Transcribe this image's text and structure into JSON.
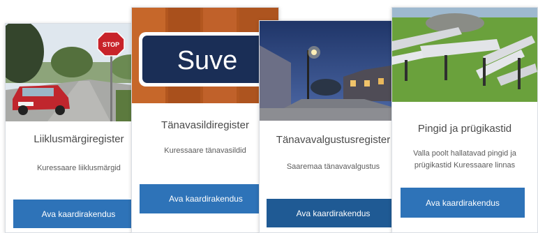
{
  "cards": [
    {
      "title": "Liiklusmärgiregister",
      "description": "Kuressaare liiklusmärgid",
      "button_label": "Ava kaardirakendus",
      "image_subject": "street-with-stop-sign-and-red-car",
      "sign_text": "STOP"
    },
    {
      "title": "Tänavasildiregister",
      "description": "Kuressaare tänavasildid",
      "button_label": "Ava kaardirakendus",
      "image_subject": "street-name-sign-on-wooden-fence",
      "sign_text": "Suve"
    },
    {
      "title": "Tänavavalgustusregister",
      "description": "Saaremaa tänavavalgustus",
      "button_label": "Ava kaardirakendus",
      "image_subject": "lit-street-at-dusk"
    },
    {
      "title": "Pingid ja prügikastid",
      "description": "Valla poolt hallatavad pingid ja prügikastid Kuressaare linnas",
      "button_label": "Ava kaardirakendus",
      "image_subject": "park-benches-and-table-on-grass"
    }
  ],
  "colors": {
    "button": "#2e73b8",
    "button_active": "#1f5a94",
    "title_text": "#4a4a4a",
    "description_text": "#5b5b5b"
  }
}
